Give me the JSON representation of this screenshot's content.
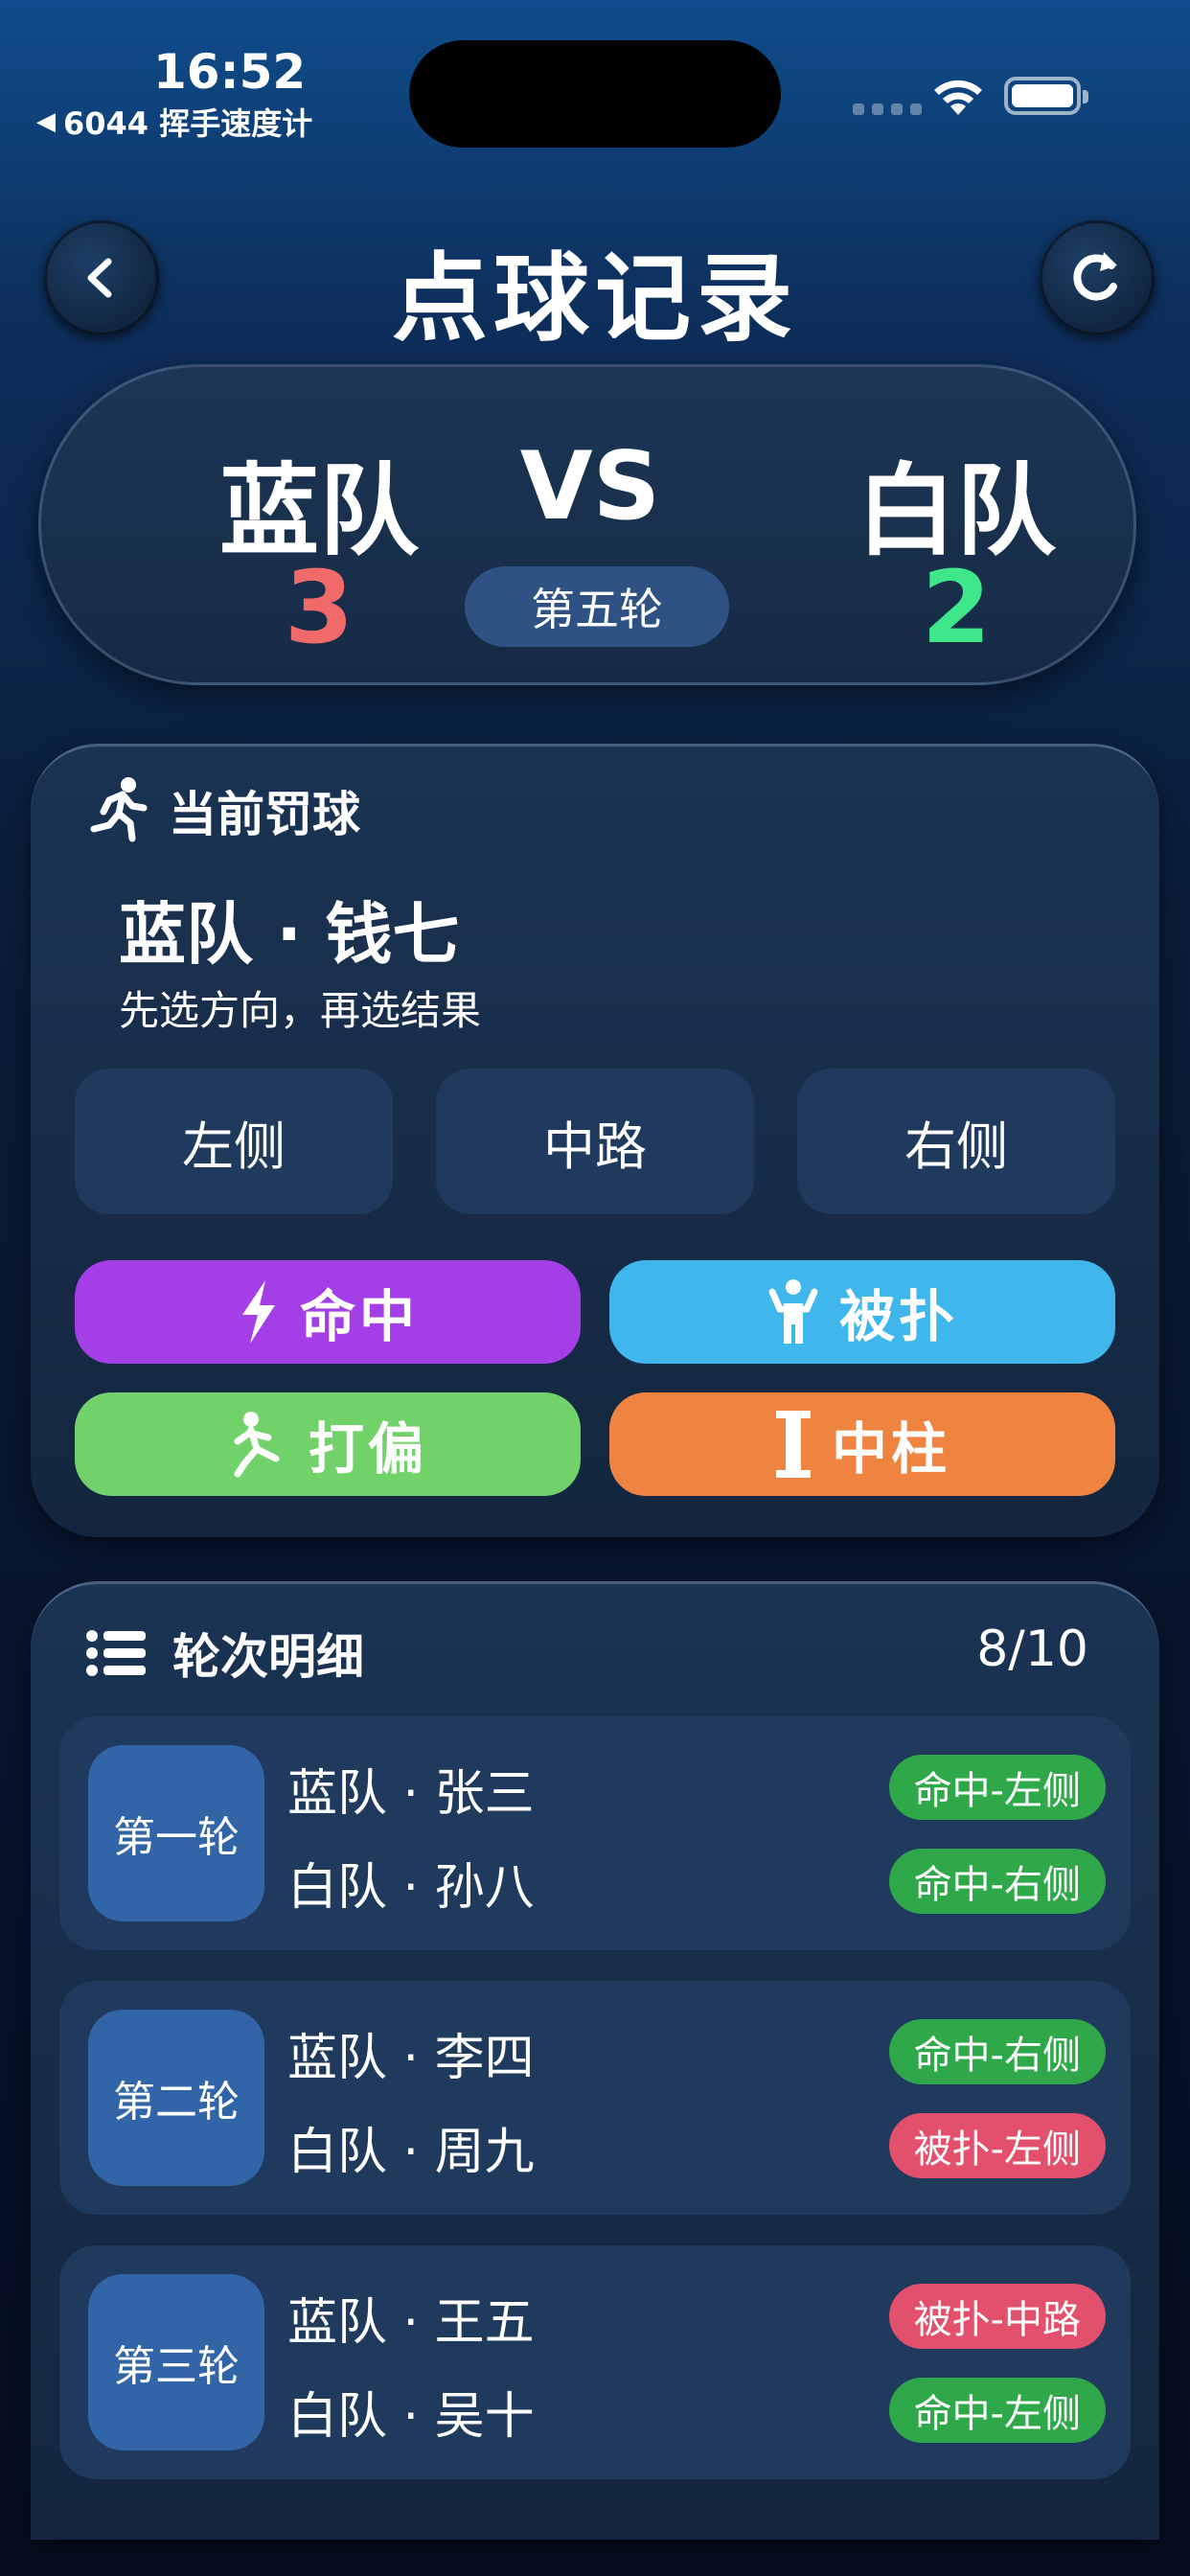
{
  "status_bar": {
    "time": "16:52",
    "back_app": "6044 挥手速度计"
  },
  "header": {
    "title": "点球记录"
  },
  "score_card": {
    "team_a": "蓝队",
    "team_b": "白队",
    "vs": "VS",
    "score_a": "3",
    "score_b": "2",
    "current_round": "第五轮",
    "score_a_color": "#f06a6a",
    "score_b_color": "#3ee88a"
  },
  "penalty": {
    "section_title": "当前罚球",
    "shooter": "蓝队 · 钱七",
    "hint": "先选方向，再选结果",
    "directions": [
      "左侧",
      "中路",
      "右侧"
    ],
    "results": {
      "hit": "命中",
      "saved": "被扑",
      "miss": "打偏",
      "post": "中柱"
    },
    "icons": {
      "section": "runner-icon",
      "hit": "lightning-icon",
      "saved": "goalkeeper-icon",
      "miss": "kick-icon",
      "post": "pillar-icon"
    }
  },
  "rounds": {
    "section_title": "轮次明细",
    "count": "8/10",
    "items": [
      {
        "label": "第一轮",
        "a_player": "蓝队 · 张三",
        "a_result": "命中-左侧",
        "b_player": "白队 · 孙八",
        "b_result": "命中-右侧"
      },
      {
        "label": "第二轮",
        "a_player": "蓝队 · 李四",
        "a_result": "命中-右侧",
        "b_player": "白队 · 周九",
        "b_result": "被扑-左侧"
      },
      {
        "label": "第三轮",
        "a_player": "蓝队 · 王五",
        "a_result": "被扑-中路",
        "b_player": "白队 · 吴十",
        "b_result": "命中-左侧"
      }
    ]
  },
  "colors": {
    "hit_green": "#2fa84a",
    "saved_red": "#e2506c",
    "btn_hit": "#a43ee6",
    "btn_saved": "#3fb6ec",
    "btn_miss": "#72d26a",
    "btn_post": "#ef8440"
  }
}
